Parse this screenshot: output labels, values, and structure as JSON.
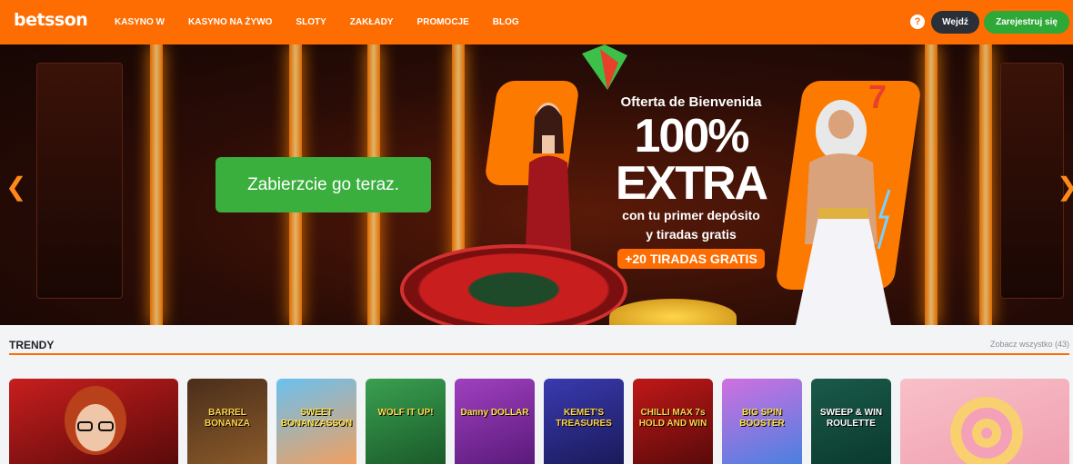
{
  "header": {
    "logo": "betsson",
    "nav": [
      "KASYNO W",
      "KASYNO NA ŻYWO",
      "SLOTY",
      "ZAKŁADY",
      "PROMOCJE",
      "BLOG"
    ],
    "help_label": "?",
    "login_label": "Wejdź",
    "register_label": "Zarejestruj się"
  },
  "hero": {
    "cta_label": "Zabierzcie go teraz.",
    "promo_title": "Ofterta de Bienvenida",
    "promo_big_1": "100%",
    "promo_big_2": "EXTRA",
    "promo_line_1": "con tu primer depósito",
    "promo_line_2": "y tiradas gratis",
    "promo_badge": "+20 TIRADAS GRATIS",
    "prev_icon": "chevron-left-icon",
    "next_icon": "chevron-right-icon"
  },
  "trending": {
    "title": "TRENDY",
    "see_all": "Zobacz wszystko (43)",
    "tiles": [
      {
        "label": ""
      },
      {
        "label": "BARREL BONANZA"
      },
      {
        "label": "SWEET BONANZASSON"
      },
      {
        "label": "WOLF IT UP!"
      },
      {
        "label": "Danny DOLLAR"
      },
      {
        "label": "KEMET'S TREASURES"
      },
      {
        "label": "CHILLI MAX 7s HOLD AND WIN"
      },
      {
        "label": "BIG SPIN BOOSTER"
      },
      {
        "label": "SWEEP & WIN ROULETTE"
      },
      {
        "label": ""
      }
    ]
  },
  "colors": {
    "brand_orange": "#fd6d02",
    "register_green": "#2ea836",
    "cta_green": "#3aaf3e",
    "login_dark": "#2b2f38"
  }
}
